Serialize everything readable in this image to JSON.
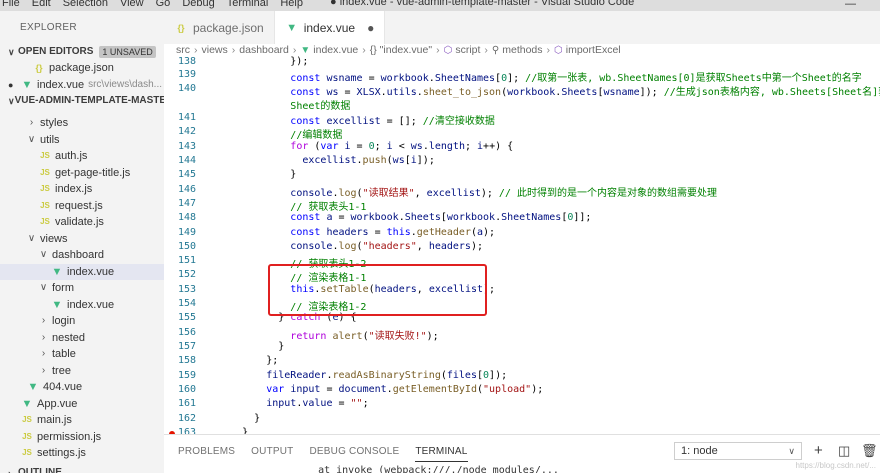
{
  "titlebar": {
    "menu": [
      "File",
      "Edit",
      "Selection",
      "View",
      "Go",
      "Debug",
      "Terminal",
      "Help"
    ],
    "title": "● index.vue - vue-admin-template-master - Visual Studio Code",
    "minimize": "—"
  },
  "sidebar": {
    "explorer_label": "EXPLORER",
    "open_editors": {
      "label": "OPEN EDITORS",
      "badge": "1 UNSAVED"
    },
    "open_files": [
      {
        "name": "package.json",
        "desc": ""
      },
      {
        "name": "index.vue",
        "desc": "src\\views\\dash..."
      }
    ],
    "project": {
      "label": "VUE-ADMIN-TEMPLATE-MASTER"
    },
    "tree": [
      {
        "type": "folder",
        "name": "styles",
        "open": false
      },
      {
        "type": "folder",
        "name": "utils",
        "open": true
      },
      {
        "type": "js",
        "name": "auth.js"
      },
      {
        "type": "js",
        "name": "get-page-title.js"
      },
      {
        "type": "js",
        "name": "index.js"
      },
      {
        "type": "js",
        "name": "request.js"
      },
      {
        "type": "js",
        "name": "validate.js"
      },
      {
        "type": "folder",
        "name": "views",
        "open": true
      },
      {
        "type": "folder",
        "name": "dashboard",
        "open": true
      },
      {
        "type": "vue",
        "name": "index.vue"
      },
      {
        "type": "folder",
        "name": "form",
        "open": true
      },
      {
        "type": "vue",
        "name": "index.vue"
      },
      {
        "type": "folder",
        "name": "login",
        "open": false
      },
      {
        "type": "folder",
        "name": "nested",
        "open": false
      },
      {
        "type": "folder",
        "name": "table",
        "open": false
      },
      {
        "type": "folder",
        "name": "tree",
        "open": false
      },
      {
        "type": "vue",
        "name": "404.vue"
      },
      {
        "type": "vue",
        "name": "App.vue"
      },
      {
        "type": "js",
        "name": "main.js"
      },
      {
        "type": "js",
        "name": "permission.js"
      },
      {
        "type": "js",
        "name": "settings.js"
      }
    ],
    "outline_label": "OUTLINE"
  },
  "tabs": [
    {
      "label": "package.json",
      "icon": "{}",
      "active": false
    },
    {
      "label": "index.vue",
      "icon": "V",
      "active": true,
      "close": "●"
    }
  ],
  "breadcrumb": [
    "src",
    "views",
    "dashboard",
    "index.vue",
    "{} \"index.vue\"",
    "script",
    "methods",
    "importExcel"
  ],
  "editor": {
    "line_numbers": [
      "138",
      "139",
      "140",
      "",
      "141",
      "142",
      "143",
      "144",
      "145",
      "146",
      "147",
      "148",
      "149",
      "150",
      "151",
      "152",
      "153",
      "154",
      "155",
      "156",
      "157",
      "158",
      "159",
      "160",
      "161",
      "162",
      "163"
    ],
    "breakpoint_line": "163"
  },
  "panel": {
    "tabs": [
      "PROBLEMS",
      "OUTPUT",
      "DEBUG CONSOLE",
      "TERMINAL"
    ],
    "active_tab": "TERMINAL",
    "terminal_select": "1: node",
    "terminal_text": "    at invoke (webpack:///./node_modules/...",
    "watermark": "https://blog.csdn.net/..."
  }
}
